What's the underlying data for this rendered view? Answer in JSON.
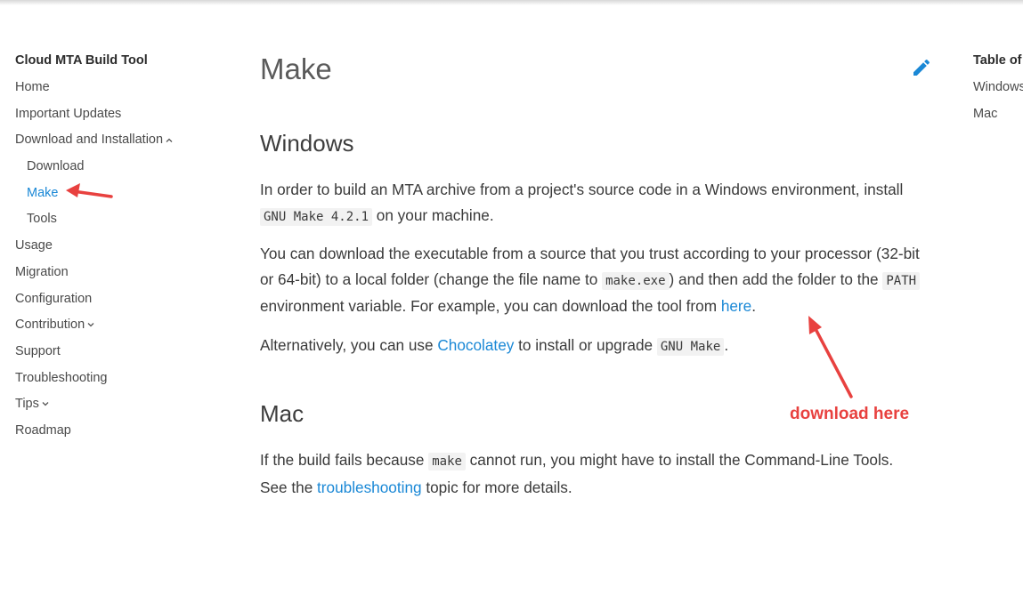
{
  "sidebar": {
    "title": "Cloud MTA Build Tool",
    "items": [
      {
        "label": "Home"
      },
      {
        "label": "Important Updates"
      },
      {
        "label": "Download and Installation"
      },
      {
        "label": "Download"
      },
      {
        "label": "Make"
      },
      {
        "label": "Tools"
      },
      {
        "label": "Usage"
      },
      {
        "label": "Migration"
      },
      {
        "label": "Configuration"
      },
      {
        "label": "Contribution"
      },
      {
        "label": "Support"
      },
      {
        "label": "Troubleshooting"
      },
      {
        "label": "Tips"
      },
      {
        "label": "Roadmap"
      }
    ]
  },
  "main": {
    "title": "Make",
    "windows": {
      "heading": "Windows",
      "p1_before": "In order to build an MTA archive from a project's source code in a Windows environment, install ",
      "p1_code": "GNU Make 4.2.1",
      "p1_after": " on your machine.",
      "p2_a": "You can download the executable from a source that you trust according to your processor (32-bit or 64-bit) to a local folder (change the file name to ",
      "p2_code1": "make.exe",
      "p2_b": ") and then add the folder to the ",
      "p2_code2": "PATH",
      "p2_c": " environment variable. For example, you can download the tool from ",
      "p2_link": "here",
      "p2_d": ".",
      "p3_a": "Alternatively, you can use ",
      "p3_link": "Chocolatey",
      "p3_b": " to install or upgrade ",
      "p3_code": "GNU Make",
      "p3_c": "."
    },
    "mac": {
      "heading": "Mac",
      "p_a": "If the build fails because ",
      "p_code": "make",
      "p_b": " cannot run, you might have to install the Command-Line Tools. See the ",
      "p_link": "troubleshooting",
      "p_c": " topic for more details."
    }
  },
  "toc": {
    "title": "Table of",
    "items": [
      {
        "label": "Windows"
      },
      {
        "label": "Mac"
      }
    ]
  },
  "annotation": {
    "text": "download here",
    "color": "#e8413f"
  },
  "colors": {
    "link": "#1a88d6",
    "text": "#3a3a3a"
  },
  "icons": {
    "edit": "pencil-icon",
    "expand": "chevron-icon"
  }
}
